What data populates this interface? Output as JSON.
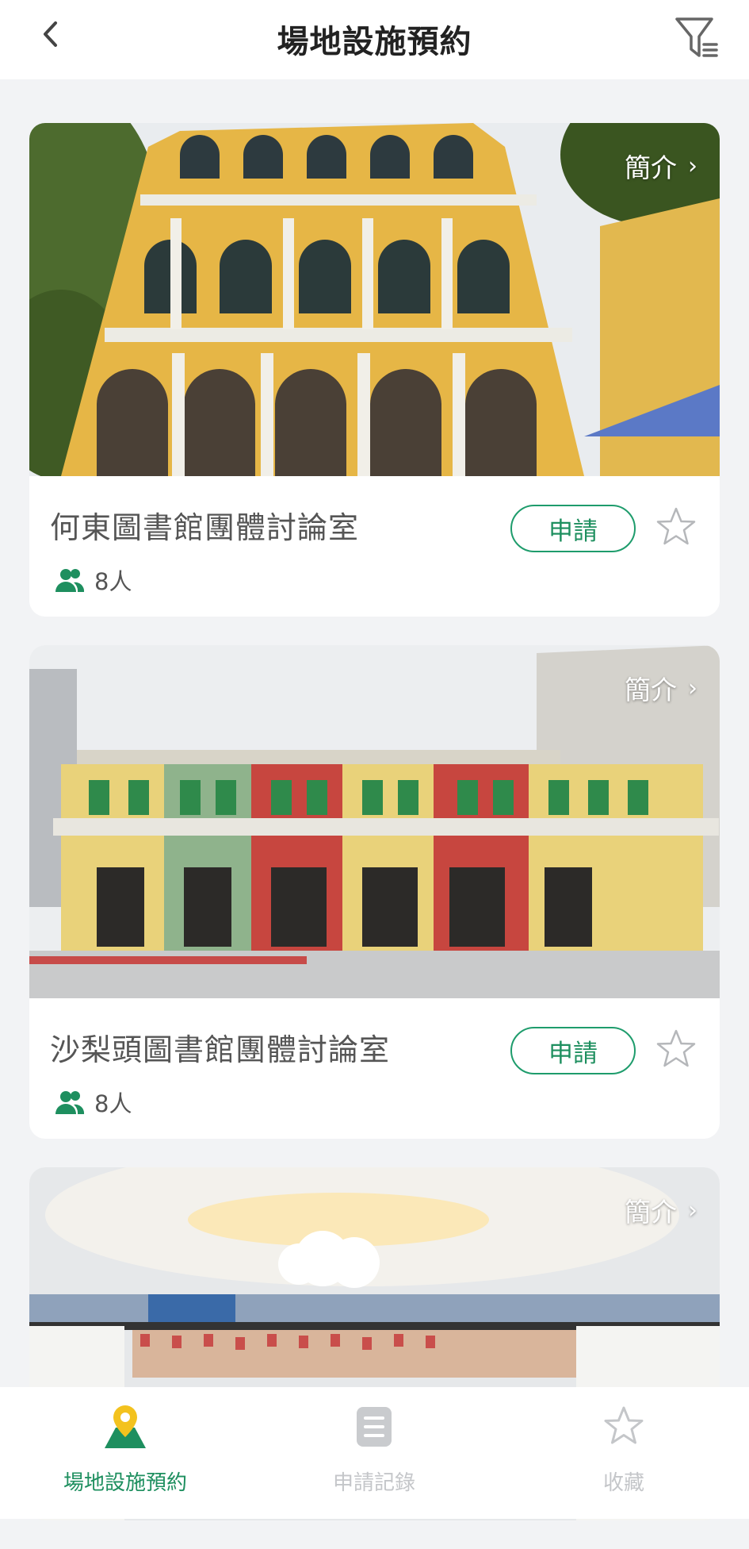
{
  "header": {
    "title": "場地設施預約"
  },
  "venues": [
    {
      "intro_label": "簡介",
      "name": "何東圖書館團體討論室",
      "capacity": "8人",
      "apply_label": "申請"
    },
    {
      "intro_label": "簡介",
      "name": "沙梨頭圖書館團體討論室",
      "capacity": "8人",
      "apply_label": "申請"
    },
    {
      "intro_label": "簡介"
    }
  ],
  "tabbar": {
    "items": [
      {
        "label": "場地設施預約",
        "active": true
      },
      {
        "label": "申請記錄",
        "active": false
      },
      {
        "label": "收藏",
        "active": false
      }
    ]
  },
  "colors": {
    "accent": "#1e8f5f",
    "inactive": "#c4c6c9",
    "background": "#f2f3f5"
  }
}
